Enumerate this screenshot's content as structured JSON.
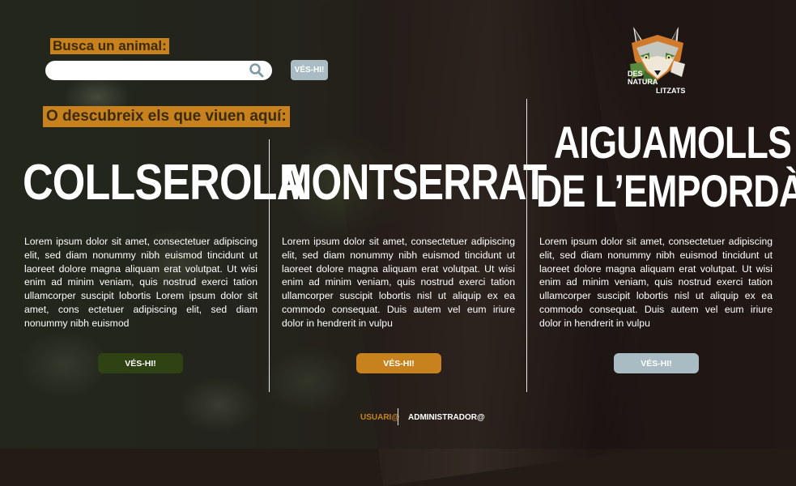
{
  "search": {
    "title": "Busca un animal:",
    "placeholder": "",
    "button_label": "VÉS-HI!"
  },
  "discover_title": "O descubreix els que viuen aquí:",
  "logo": {
    "line1": "DES",
    "line2": "NATURA",
    "line3": "LITZATS"
  },
  "columns": [
    {
      "title": "COLLSEROLA",
      "text": "Lorem ipsum dolor sit amet, consectetuer adipiscing elit, sed diam nonummy nibh euismod tincidunt ut laoreet dolore magna aliquam erat volutpat. Ut wisi enim ad minim veniam, quis nostrud exerci tation ullamcorper suscipit lobortis Lorem ipsum dolor sit amet, cons ectetuer adipiscing elit, sed diam nonummy nibh euismod",
      "button_label": "VÉS-HI!",
      "button_color": "#2e4213"
    },
    {
      "title": "MONTSERRAT",
      "text": "Lorem ipsum dolor sit amet, consectetuer adipiscing elit, sed diam nonummy nibh euismod tincidunt ut laoreet dolore magna aliquam erat volutpat. Ut wisi enim ad minim veniam, quis nostrud exerci tation ullamcorper suscipit lobortis nisl ut aliquip ex ea commodo consequat. Duis autem vel eum iriure dolor in hendrerit in vulpu",
      "button_label": "VÉS-HI!",
      "button_color": "#c8821d"
    },
    {
      "title_line1": "AIGUAMOLLS",
      "title_line2": "DE L’EMPORDÀ",
      "text": "Lorem ipsum dolor sit amet, consectetuer adipiscing elit, sed diam nonummy nibh euismod tincidunt ut laoreet dolore magna aliquam erat volutpat. Ut wisi enim ad minim veniam, quis nostrud exerci tation ullamcorper suscipit lobortis nisl ut aliquip ex ea commodo consequat. Duis autem vel eum iriure dolor in hendrerit in vulpu",
      "button_label": "VÉS-HI!",
      "button_color": "#a9bcc4"
    }
  ],
  "footer": {
    "user_label": "USUARI@",
    "admin_label": "ADMINISTRADOR@",
    "user_color": "#c8821d"
  }
}
